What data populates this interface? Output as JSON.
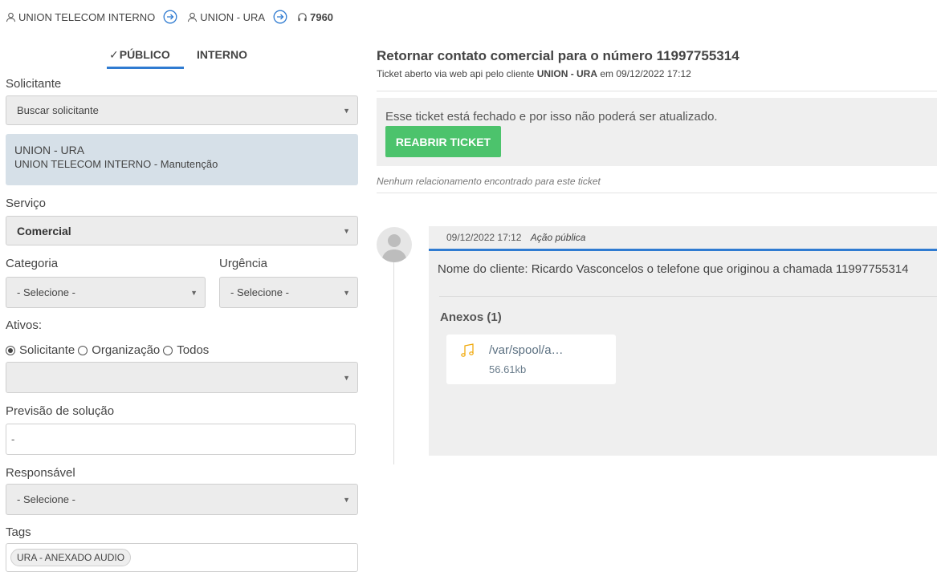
{
  "breadcrumb": {
    "org": "UNION TELECOM INTERNO",
    "client": "UNION - URA",
    "ticket_number": "7960"
  },
  "tabs": [
    {
      "label": "PÚBLICO",
      "active": true
    },
    {
      "label": "INTERNO",
      "active": false
    }
  ],
  "form": {
    "solicitante_label": "Solicitante",
    "solicitante_placeholder": "Buscar solicitante",
    "solicitante_card": {
      "name": "UNION - URA",
      "detail": "UNION TELECOM INTERNO - Manutenção"
    },
    "servico_label": "Serviço",
    "servico_value": "Comercial",
    "categoria_label": "Categoria",
    "categoria_value": "- Selecione -",
    "urgencia_label": "Urgência",
    "urgencia_value": "- Selecione -",
    "ativos_label": "Ativos:",
    "ativos_options": [
      "Solicitante",
      "Organização",
      "Todos"
    ],
    "ativos_selected": "Solicitante",
    "previsao_label": "Previsão de solução",
    "previsao_value": "-",
    "responsavel_label": "Responsável",
    "responsavel_value": "- Selecione -",
    "tags_label": "Tags",
    "tags": [
      "URA - ANEXADO AUDIO"
    ]
  },
  "ticket": {
    "title": "Retornar contato comercial para o número 11997755314",
    "subtitle_prefix": "Ticket aberto via web api pelo cliente",
    "subtitle_client": "UNION - URA",
    "subtitle_suffix": "em 09/12/2022 17:12",
    "closed_message": "Esse ticket está fechado e por isso não poderá ser atualizado.",
    "reopen_label": "REABRIR TICKET",
    "no_relations": "Nenhum relacionamento encontrado para este ticket"
  },
  "entry": {
    "timestamp": "09/12/2022 17:12",
    "action": "Ação pública",
    "body": "Nome do cliente: Ricardo Vasconcelos o telefone que originou a chamada 11997755314",
    "attachments_label": "Anexos (1)",
    "attachment": {
      "name": "/var/spool/a…",
      "size": "56.61kb",
      "icon": "music-note-icon"
    }
  },
  "colors": {
    "accent": "#2f7bd1",
    "success": "#4cc36c",
    "attachment_icon": "#f0a500"
  }
}
